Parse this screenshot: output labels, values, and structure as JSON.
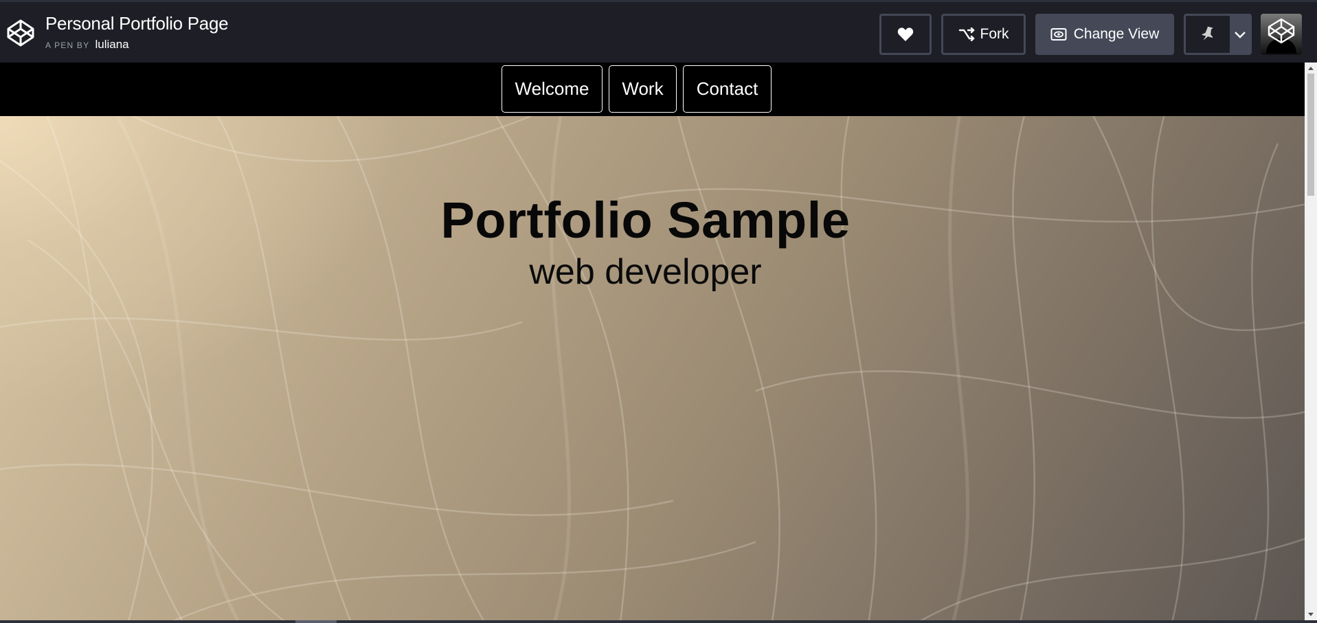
{
  "header": {
    "title": "Personal Portfolio Page",
    "by_label": "A PEN BY",
    "author": "luliana",
    "buttons": {
      "fork": "Fork",
      "change_view": "Change View"
    },
    "icons": [
      "codepen-logo-icon",
      "heart-icon",
      "fork-icon",
      "eye-icon",
      "pin-icon",
      "chevron-down-icon"
    ]
  },
  "preview": {
    "nav": {
      "items": [
        {
          "label": "Welcome"
        },
        {
          "label": "Work"
        },
        {
          "label": "Contact"
        }
      ]
    },
    "hero": {
      "title": "Portfolio Sample",
      "subtitle": "web developer"
    }
  },
  "colors": {
    "header_bg": "#1e1f26",
    "button_border": "#444857",
    "nav_bg": "#000000"
  }
}
